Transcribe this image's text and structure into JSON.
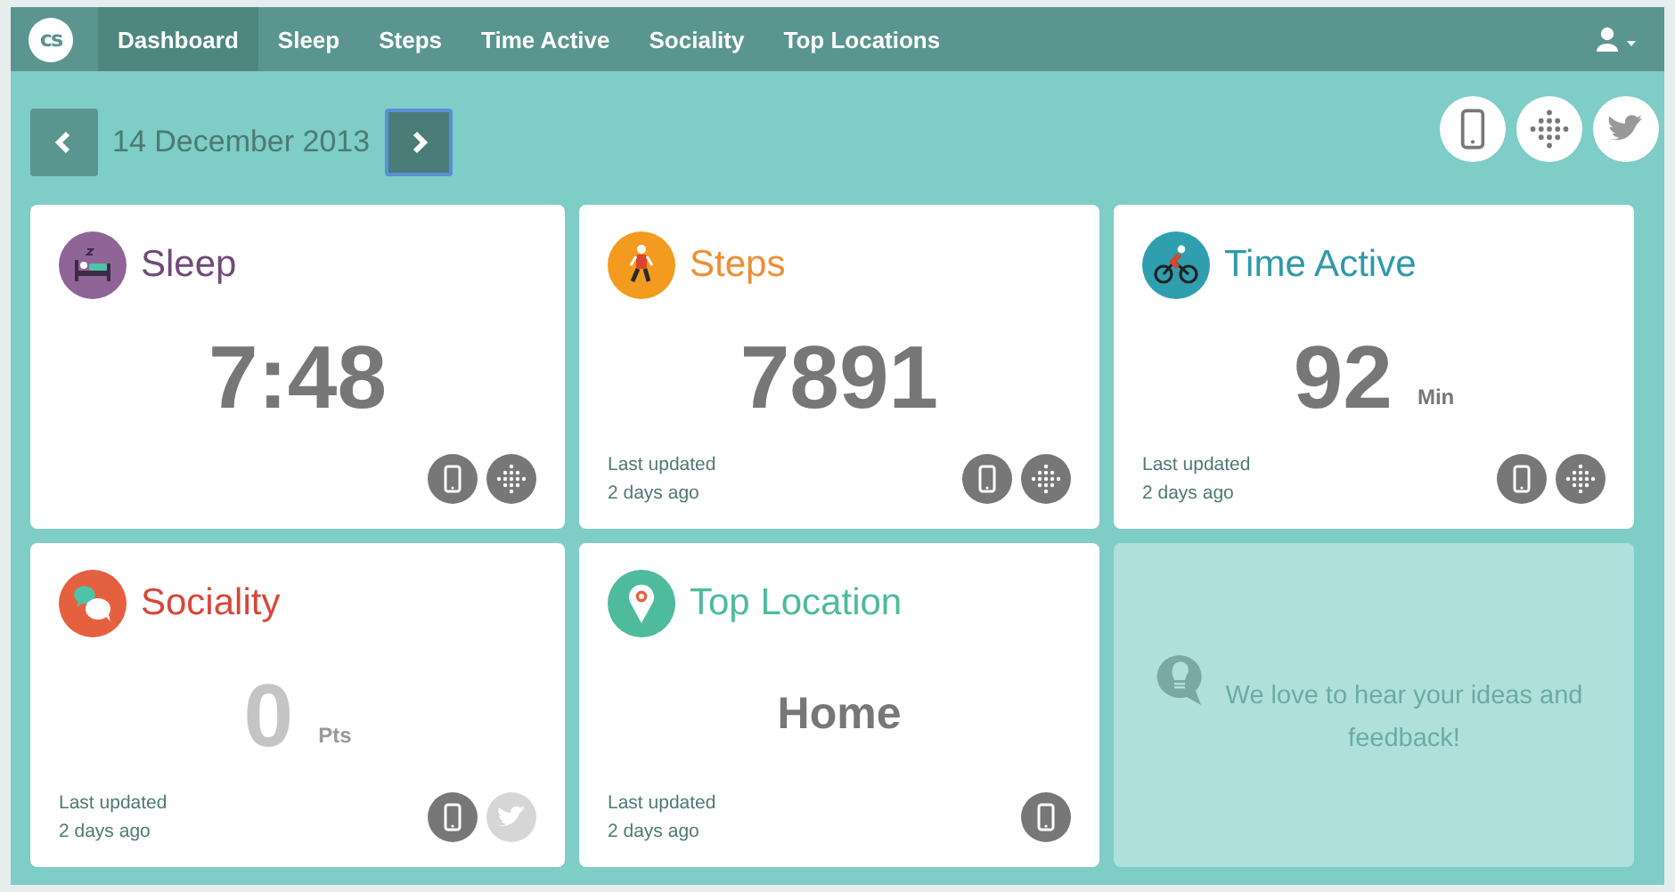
{
  "nav": {
    "logo": "cs",
    "tabs": [
      {
        "label": "Dashboard",
        "selected": true
      },
      {
        "label": "Sleep",
        "selected": false
      },
      {
        "label": "Steps",
        "selected": false
      },
      {
        "label": "Time Active",
        "selected": false
      },
      {
        "label": "Sociality",
        "selected": false
      },
      {
        "label": "Top Locations",
        "selected": false
      }
    ]
  },
  "date_bar": {
    "date": "14 December 2013",
    "prev_focused": false,
    "next_focused": true,
    "sources": [
      {
        "kind": "phone"
      },
      {
        "kind": "fitbit"
      },
      {
        "kind": "twitter"
      }
    ]
  },
  "cards": [
    {
      "kind": "metric",
      "title": "Sleep",
      "color": "#6f4a79",
      "value": "7:48",
      "dimmed": false,
      "sources": [
        {
          "kind": "phone",
          "active": true
        },
        {
          "kind": "fitbit",
          "active": true
        }
      ]
    },
    {
      "kind": "metric",
      "title": "Steps",
      "color": "#ee8e33",
      "value": "7891",
      "dimmed": false,
      "updated": [
        "Last updated",
        "2 days ago"
      ],
      "sources": [
        {
          "kind": "phone",
          "active": true
        },
        {
          "kind": "fitbit",
          "active": true
        }
      ]
    },
    {
      "kind": "metric",
      "title": "Time Active",
      "color": "#2e9aaa",
      "value": "92",
      "unit": "Min",
      "dimmed": false,
      "updated": [
        "Last updated",
        "2 days ago"
      ],
      "sources": [
        {
          "kind": "phone",
          "active": true
        },
        {
          "kind": "fitbit",
          "active": true
        }
      ]
    },
    {
      "kind": "metric",
      "title": "Sociality",
      "color": "#d8473a",
      "value": "0",
      "unit": "Pts",
      "dimmed": true,
      "updated": [
        "Last updated",
        "2 days ago"
      ],
      "sources": [
        {
          "kind": "phone",
          "active": true
        },
        {
          "kind": "twitter",
          "active": false
        }
      ]
    },
    {
      "kind": "place",
      "title": "Top Location",
      "color": "#4dbb9c",
      "value": "Home",
      "updated": [
        "Last updated",
        "2 days ago"
      ],
      "sources": [
        {
          "kind": "phone",
          "active": true
        }
      ]
    },
    {
      "kind": "feedback",
      "text": "We love to hear your ideas and feedback!"
    }
  ]
}
